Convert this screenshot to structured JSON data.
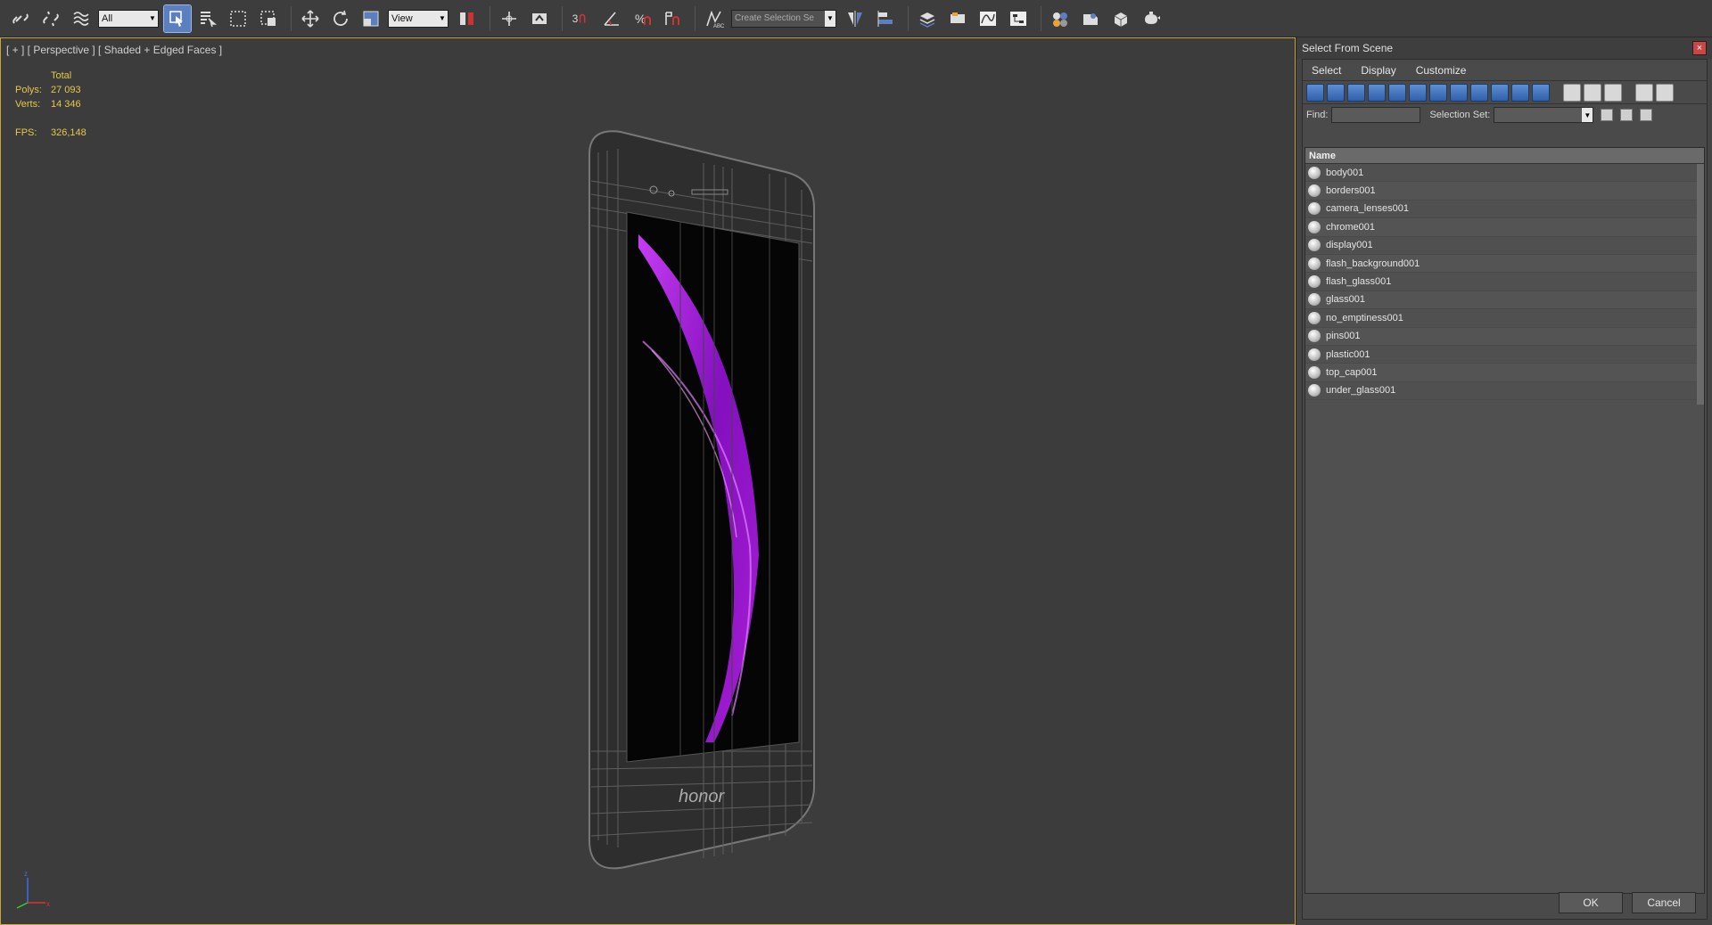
{
  "toolbar": {
    "filter_value": "All",
    "coord_system": "View",
    "snap_number": "3",
    "named_selection_placeholder": "Create Selection Se",
    "icons": [
      "link-icon",
      "unlink-icon",
      "bind-space-warp-icon",
      "select-icon",
      "select-by-name-icon",
      "rect-region-icon",
      "window-crossing-icon",
      "move-icon",
      "rotate-icon",
      "scale-icon",
      "pivot-icon",
      "mirror-icon",
      "snap-icon",
      "angle-snap-icon",
      "percent-snap-icon",
      "spinner-snap-icon",
      "edit-named-sets-icon",
      "mirror-icon",
      "align-icon",
      "layer-icon",
      "curve-editor-icon",
      "schematic-icon",
      "material-editor-icon",
      "render-setup-icon",
      "render-frame-icon",
      "render-icon"
    ]
  },
  "viewport": {
    "label": "[ + ] [ Perspective ] [ Shaded + Edged Faces ]",
    "stats_header": "Total",
    "polys_label": "Polys:",
    "polys_value": "27 093",
    "verts_label": "Verts:",
    "verts_value": "14 346",
    "fps_label": "FPS:",
    "fps_value": "326,148",
    "phone_logo": "honor"
  },
  "dialog": {
    "title": "Select From Scene",
    "close_label": "×",
    "menu": {
      "select": "Select",
      "display": "Display",
      "customize": "Customize"
    },
    "find_label": "Find:",
    "selection_set_label": "Selection Set:",
    "list_header": "Name",
    "objects": [
      "body001",
      "borders001",
      "camera_lenses001",
      "chrome001",
      "display001",
      "flash_background001",
      "flash_glass001",
      "glass001",
      "no_emptiness001",
      "pins001",
      "plastic001",
      "top_cap001",
      "under_glass001"
    ],
    "ok_label": "OK",
    "cancel_label": "Cancel"
  },
  "colors": {
    "viewport_bg": "#3c3c3c",
    "stats": "#e6c84a",
    "accent": "#5b7fbf",
    "screen_purple": "#a020d0"
  }
}
